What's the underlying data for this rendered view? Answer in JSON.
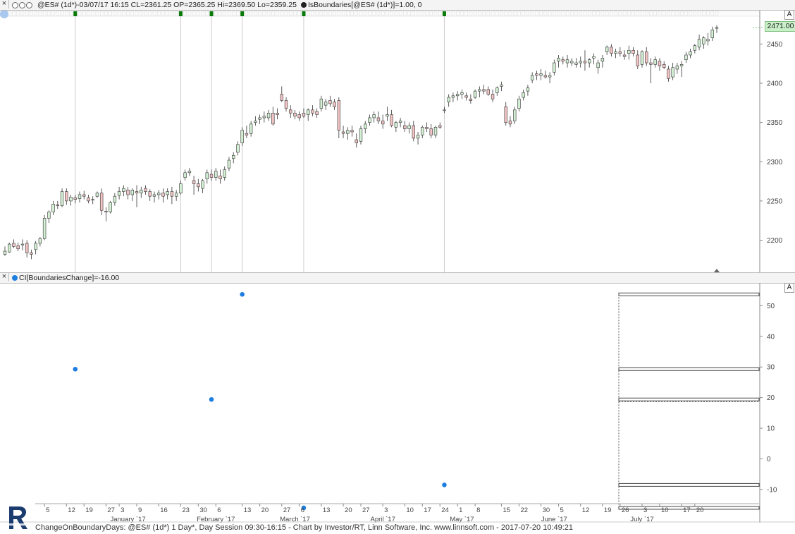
{
  "top_panel": {
    "series_label": "@ES# (1d*)-03/07/17 16:15 CL=2361.25 OP=2365.25 Hi=2369.50 Lo=2359.25",
    "study_label": "IsBoundaries[@ES# (1d*)]=1.00, 0",
    "last_price": "2471.00",
    "scale_button": "A",
    "close_label": "×"
  },
  "bottom_panel": {
    "study_label": "CI[BoundariesChange]=-16.00",
    "scale_button": "A",
    "close_label": "×"
  },
  "footer": {
    "text": "ChangeOnBoundaryDays: @ES# (1d*) 1 Day*, Day Session 09:30-16:15 - Chart by Investor/RT, Linn Software, Inc. www.linnsoft.com - 2017-07-20 10:49:21"
  },
  "colors": {
    "up_fill": "#d4f0d4",
    "down_fill": "#f2c4c4",
    "candle_outline": "#333333",
    "dot": "#1e7ee0",
    "marker": "#0a7a0a",
    "boundary_line": "#cccccc"
  },
  "chart_data": [
    {
      "type": "candlestick",
      "series_name": "@ES# (1d*)",
      "ylim": [
        2160,
        2480
      ],
      "y_ticks": [
        2200,
        2250,
        2300,
        2350,
        2400,
        2450
      ],
      "boundary_bar_indices": [
        16,
        40,
        47,
        54,
        68,
        100
      ],
      "ohlc": [
        [
          2182,
          2192,
          2180,
          2186
        ],
        [
          2185,
          2197,
          2184,
          2195
        ],
        [
          2196,
          2201,
          2190,
          2192
        ],
        [
          2193,
          2197,
          2186,
          2189
        ],
        [
          2194,
          2201,
          2187,
          2195
        ],
        [
          2196,
          2200,
          2178,
          2184
        ],
        [
          2184,
          2188,
          2176,
          2182
        ],
        [
          2188,
          2199,
          2182,
          2196
        ],
        [
          2196,
          2204,
          2192,
          2202
        ],
        [
          2202,
          2232,
          2200,
          2228
        ],
        [
          2228,
          2238,
          2222,
          2236
        ],
        [
          2236,
          2250,
          2232,
          2246
        ],
        [
          2245,
          2250,
          2240,
          2244
        ],
        [
          2244,
          2266,
          2242,
          2262
        ],
        [
          2262,
          2266,
          2245,
          2250
        ],
        [
          2250,
          2258,
          2244,
          2255
        ],
        [
          2254,
          2258,
          2247,
          2252
        ],
        [
          2253,
          2262,
          2248,
          2258
        ],
        [
          2258,
          2263,
          2252,
          2256
        ],
        [
          2254,
          2258,
          2247,
          2250
        ],
        [
          2251,
          2256,
          2246,
          2252
        ],
        [
          2256,
          2262,
          2254,
          2260
        ],
        [
          2260,
          2266,
          2232,
          2238
        ],
        [
          2237,
          2242,
          2224,
          2236
        ],
        [
          2236,
          2250,
          2234,
          2248
        ],
        [
          2248,
          2260,
          2244,
          2256
        ],
        [
          2257,
          2268,
          2252,
          2262
        ],
        [
          2262,
          2270,
          2256,
          2266
        ],
        [
          2264,
          2268,
          2252,
          2258
        ],
        [
          2258,
          2266,
          2250,
          2264
        ],
        [
          2262,
          2270,
          2242,
          2260
        ],
        [
          2260,
          2268,
          2254,
          2264
        ],
        [
          2266,
          2270,
          2258,
          2262
        ],
        [
          2262,
          2265,
          2250,
          2256
        ],
        [
          2256,
          2262,
          2248,
          2258
        ],
        [
          2258,
          2264,
          2252,
          2260
        ],
        [
          2260,
          2266,
          2248,
          2256
        ],
        [
          2258,
          2266,
          2252,
          2262
        ],
        [
          2262,
          2268,
          2246,
          2256
        ],
        [
          2256,
          2264,
          2250,
          2260
        ],
        [
          2260,
          2276,
          2258,
          2272
        ],
        [
          2280,
          2290,
          2276,
          2286
        ],
        [
          2286,
          2292,
          2282,
          2288
        ],
        [
          2276,
          2282,
          2258,
          2272
        ],
        [
          2272,
          2278,
          2262,
          2268
        ],
        [
          2266,
          2278,
          2260,
          2276
        ],
        [
          2278,
          2290,
          2272,
          2286
        ],
        [
          2284,
          2290,
          2276,
          2280
        ],
        [
          2280,
          2292,
          2276,
          2288
        ],
        [
          2282,
          2290,
          2272,
          2278
        ],
        [
          2280,
          2294,
          2276,
          2290
        ],
        [
          2292,
          2306,
          2288,
          2302
        ],
        [
          2304,
          2312,
          2298,
          2308
        ],
        [
          2312,
          2326,
          2308,
          2322
        ],
        [
          2324,
          2344,
          2320,
          2340
        ],
        [
          2336,
          2346,
          2330,
          2334
        ],
        [
          2336,
          2352,
          2332,
          2348
        ],
        [
          2350,
          2358,
          2346,
          2352
        ],
        [
          2354,
          2360,
          2348,
          2356
        ],
        [
          2356,
          2364,
          2350,
          2358
        ],
        [
          2356,
          2366,
          2352,
          2362
        ],
        [
          2362,
          2370,
          2346,
          2348
        ],
        [
          2362,
          2368,
          2354,
          2360
        ],
        [
          2386,
          2396,
          2376,
          2378
        ],
        [
          2378,
          2382,
          2364,
          2368
        ],
        [
          2366,
          2372,
          2356,
          2362
        ],
        [
          2362,
          2366,
          2354,
          2358
        ],
        [
          2360,
          2364,
          2352,
          2356
        ],
        [
          2362,
          2368,
          2356,
          2358
        ],
        [
          2360,
          2368,
          2352,
          2366
        ],
        [
          2366,
          2372,
          2358,
          2362
        ],
        [
          2364,
          2368,
          2356,
          2360
        ],
        [
          2368,
          2384,
          2364,
          2380
        ],
        [
          2372,
          2380,
          2366,
          2376
        ],
        [
          2378,
          2384,
          2370,
          2374
        ],
        [
          2376,
          2380,
          2366,
          2370
        ],
        [
          2378,
          2382,
          2330,
          2340
        ],
        [
          2338,
          2346,
          2330,
          2336
        ],
        [
          2336,
          2344,
          2328,
          2340
        ],
        [
          2340,
          2346,
          2332,
          2338
        ],
        [
          2328,
          2336,
          2318,
          2324
        ],
        [
          2326,
          2346,
          2322,
          2342
        ],
        [
          2342,
          2352,
          2336,
          2348
        ],
        [
          2350,
          2360,
          2346,
          2356
        ],
        [
          2356,
          2364,
          2350,
          2360
        ],
        [
          2356,
          2364,
          2348,
          2352
        ],
        [
          2352,
          2360,
          2342,
          2348
        ],
        [
          2358,
          2370,
          2352,
          2360
        ],
        [
          2360,
          2366,
          2344,
          2346
        ],
        [
          2344,
          2352,
          2338,
          2350
        ],
        [
          2350,
          2356,
          2344,
          2352
        ],
        [
          2346,
          2352,
          2338,
          2342
        ],
        [
          2342,
          2350,
          2336,
          2346
        ],
        [
          2346,
          2352,
          2326,
          2330
        ],
        [
          2330,
          2338,
          2322,
          2334
        ],
        [
          2334,
          2346,
          2330,
          2344
        ],
        [
          2344,
          2350,
          2338,
          2342
        ],
        [
          2342,
          2348,
          2330,
          2334
        ],
        [
          2334,
          2346,
          2330,
          2344
        ],
        [
          2346,
          2350,
          2342,
          2344
        ],
        [
          2366,
          2370,
          2362,
          2366
        ],
        [
          2376,
          2386,
          2370,
          2382
        ],
        [
          2382,
          2388,
          2376,
          2384
        ],
        [
          2384,
          2390,
          2378,
          2386
        ],
        [
          2386,
          2392,
          2380,
          2388
        ],
        [
          2384,
          2388,
          2378,
          2382
        ],
        [
          2380,
          2386,
          2374,
          2378
        ],
        [
          2382,
          2392,
          2380,
          2390
        ],
        [
          2390,
          2396,
          2382,
          2392
        ],
        [
          2392,
          2398,
          2386,
          2390
        ],
        [
          2392,
          2396,
          2384,
          2386
        ],
        [
          2386,
          2392,
          2376,
          2380
        ],
        [
          2388,
          2396,
          2384,
          2394
        ],
        [
          2396,
          2402,
          2390,
          2398
        ],
        [
          2370,
          2376,
          2346,
          2350
        ],
        [
          2352,
          2358,
          2344,
          2348
        ],
        [
          2352,
          2370,
          2348,
          2366
        ],
        [
          2368,
          2384,
          2364,
          2380
        ],
        [
          2382,
          2392,
          2378,
          2388
        ],
        [
          2390,
          2398,
          2384,
          2394
        ],
        [
          2404,
          2414,
          2400,
          2410
        ],
        [
          2412,
          2416,
          2404,
          2410
        ],
        [
          2410,
          2418,
          2404,
          2412
        ],
        [
          2410,
          2416,
          2406,
          2408
        ],
        [
          2408,
          2414,
          2400,
          2410
        ],
        [
          2414,
          2430,
          2410,
          2426
        ],
        [
          2428,
          2436,
          2420,
          2432
        ],
        [
          2430,
          2434,
          2424,
          2428
        ],
        [
          2426,
          2436,
          2420,
          2430
        ],
        [
          2426,
          2432,
          2422,
          2428
        ],
        [
          2424,
          2432,
          2420,
          2426
        ],
        [
          2426,
          2434,
          2420,
          2428
        ],
        [
          2428,
          2442,
          2416,
          2426
        ],
        [
          2426,
          2432,
          2420,
          2430
        ],
        [
          2432,
          2438,
          2424,
          2434
        ],
        [
          2420,
          2430,
          2412,
          2426
        ],
        [
          2428,
          2436,
          2420,
          2432
        ],
        [
          2440,
          2448,
          2436,
          2446
        ],
        [
          2446,
          2450,
          2434,
          2438
        ],
        [
          2438,
          2444,
          2432,
          2440
        ],
        [
          2440,
          2446,
          2434,
          2438
        ],
        [
          2436,
          2442,
          2430,
          2434
        ],
        [
          2438,
          2448,
          2430,
          2442
        ],
        [
          2442,
          2446,
          2434,
          2438
        ],
        [
          2436,
          2442,
          2418,
          2422
        ],
        [
          2424,
          2442,
          2420,
          2440
        ],
        [
          2440,
          2446,
          2422,
          2426
        ],
        [
          2426,
          2432,
          2400,
          2424
        ],
        [
          2424,
          2434,
          2420,
          2430
        ],
        [
          2428,
          2432,
          2416,
          2422
        ],
        [
          2424,
          2428,
          2418,
          2420
        ],
        [
          2418,
          2422,
          2402,
          2406
        ],
        [
          2408,
          2426,
          2404,
          2420
        ],
        [
          2418,
          2426,
          2412,
          2422
        ],
        [
          2422,
          2428,
          2408,
          2424
        ],
        [
          2430,
          2440,
          2426,
          2436
        ],
        [
          2436,
          2444,
          2432,
          2440
        ],
        [
          2442,
          2450,
          2438,
          2448
        ],
        [
          2446,
          2462,
          2442,
          2456
        ],
        [
          2450,
          2460,
          2444,
          2458
        ],
        [
          2454,
          2464,
          2448,
          2456
        ],
        [
          2458,
          2472,
          2454,
          2468
        ],
        [
          2470,
          2474,
          2464,
          2471
        ]
      ]
    },
    {
      "type": "scatter",
      "series_name": "CI[BoundariesChange]",
      "ylim": [
        -19,
        57
      ],
      "y_ticks": [
        -10,
        0,
        10,
        20,
        30,
        40,
        50
      ],
      "points": [
        {
          "bar": 16,
          "value": 29.3
        },
        {
          "bar": 47,
          "value": 19.4
        },
        {
          "bar": 54,
          "value": 53.7
        },
        {
          "bar": 68,
          "value": -16.0
        },
        {
          "bar": 100,
          "value": -8.5
        }
      ],
      "levels": [
        53.7,
        29.3,
        19.4,
        -8.5,
        -16.0
      ],
      "x_ticks": [
        {
          "bar": 9,
          "label": "5"
        },
        {
          "bar": 14,
          "label": "12"
        },
        {
          "bar": 18,
          "label": "19"
        },
        {
          "bar": 23,
          "label": "27"
        },
        {
          "bar": 26,
          "label": "3"
        },
        {
          "bar": 30,
          "label": "9"
        },
        {
          "bar": 35,
          "label": "16"
        },
        {
          "bar": 40,
          "label": "23"
        },
        {
          "bar": 44,
          "label": "30"
        },
        {
          "bar": 48,
          "label": "6"
        },
        {
          "bar": 54,
          "label": "13"
        },
        {
          "bar": 58,
          "label": "20"
        },
        {
          "bar": 63,
          "label": "27"
        },
        {
          "bar": 67,
          "label": "6"
        },
        {
          "bar": 72,
          "label": "13"
        },
        {
          "bar": 77,
          "label": "20"
        },
        {
          "bar": 81,
          "label": "27"
        },
        {
          "bar": 86,
          "label": "3"
        },
        {
          "bar": 91,
          "label": "10"
        },
        {
          "bar": 95,
          "label": "17"
        },
        {
          "bar": 99,
          "label": "24"
        },
        {
          "bar": 103,
          "label": "1"
        },
        {
          "bar": 107,
          "label": "8"
        },
        {
          "bar": 113,
          "label": "15"
        },
        {
          "bar": 117,
          "label": "22"
        },
        {
          "bar": 122,
          "label": "30"
        },
        {
          "bar": 126,
          "label": "5"
        },
        {
          "bar": 131,
          "label": "12"
        },
        {
          "bar": 136,
          "label": "19"
        },
        {
          "bar": 140,
          "label": "26"
        },
        {
          "bar": 145,
          "label": "3"
        },
        {
          "bar": 149,
          "label": "10"
        },
        {
          "bar": 154,
          "label": "17"
        },
        {
          "bar": 157,
          "label": "20"
        }
      ],
      "month_labels": [
        {
          "bar": 28,
          "label": "January `17"
        },
        {
          "bar": 48,
          "label": "February `17"
        },
        {
          "bar": 66,
          "label": "March `17"
        },
        {
          "bar": 86,
          "label": "April `17"
        },
        {
          "bar": 104,
          "label": "May `17"
        },
        {
          "bar": 125,
          "label": "June `17"
        },
        {
          "bar": 145,
          "label": "July `17"
        }
      ]
    }
  ]
}
